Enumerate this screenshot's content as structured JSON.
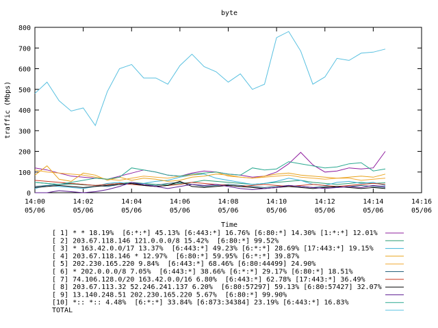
{
  "chart_data": {
    "type": "line",
    "title": "byte",
    "xlabel": "Time",
    "ylabel": "traffic (Mbps)",
    "xlim": [
      0,
      16
    ],
    "ylim": [
      0,
      800
    ],
    "grid": false,
    "legend_placement": "bottom",
    "x_ticks": [
      {
        "value": 0,
        "time": "14:00",
        "date": "05/06"
      },
      {
        "value": 2,
        "time": "14:02",
        "date": "05/06"
      },
      {
        "value": 4,
        "time": "14:04",
        "date": "05/06"
      },
      {
        "value": 6,
        "time": "14:06",
        "date": "05/06"
      },
      {
        "value": 8,
        "time": "14:08",
        "date": "05/06"
      },
      {
        "value": 10,
        "time": "14:10",
        "date": "05/06"
      },
      {
        "value": 12,
        "time": "14:12",
        "date": "05/06"
      },
      {
        "value": 14,
        "time": "14:14",
        "date": "05/06"
      },
      {
        "value": 16,
        "time": "14:16",
        "date": "05/06"
      }
    ],
    "y_ticks": [
      0,
      100,
      200,
      300,
      400,
      500,
      600,
      700,
      800
    ],
    "x": [
      0,
      0.5,
      1,
      1.5,
      2,
      2.5,
      3,
      3.5,
      4,
      4.5,
      5,
      5.5,
      6,
      6.5,
      7,
      7.5,
      8,
      8.5,
      9,
      9.5,
      10,
      10.5,
      11,
      11.5,
      12,
      12.5,
      13,
      13.5,
      14,
      14.5
    ],
    "series": [
      {
        "name": "[ 1] * * 18.19%  [6:*:*] 45.13% [6:443:*] 16.76% [6:80:*] 14.30% [1:*:*] 12.01%",
        "color": "#8e1c9e",
        "values": [
          120,
          110,
          95,
          80,
          75,
          70,
          65,
          80,
          95,
          110,
          100,
          85,
          80,
          95,
          105,
          100,
          90,
          85,
          75,
          80,
          100,
          140,
          195,
          135,
          100,
          105,
          120,
          115,
          120,
          200
        ]
      },
      {
        "name": "[ 2] 203.67.118.146 121.0.0.0/8 15.42%  [6:80:*] 99.52%",
        "color": "#2a9c74",
        "values": [
          50,
          45,
          40,
          42,
          38,
          35,
          40,
          45,
          50,
          45,
          40,
          38,
          45,
          50,
          60,
          55,
          50,
          45,
          40,
          45,
          50,
          55,
          60,
          50,
          45,
          40,
          45,
          50,
          45,
          48
        ]
      },
      {
        "name": "[ 3] * 163.42.0.0/17 13.37%  [6:443:*] 49.23% [6:*:*] 28.69% [17:443:*] 19.15%",
        "color": "#3cb2d8",
        "values": [
          20,
          35,
          30,
          25,
          20,
          30,
          45,
          50,
          40,
          45,
          55,
          60,
          75,
          85,
          90,
          70,
          60,
          50,
          40,
          45,
          55,
          70,
          60,
          40,
          35,
          50,
          55,
          45,
          50,
          35
        ]
      },
      {
        "name": "[ 4] 203.67.118.146 * 12.97%  [6:80:*] 59.95% [6:*:*] 39.87%",
        "color": "#e8a21a",
        "values": [
          85,
          130,
          65,
          55,
          95,
          85,
          60,
          75,
          60,
          70,
          65,
          55,
          60,
          75,
          80,
          90,
          85,
          75,
          70,
          80,
          90,
          95,
          85,
          80,
          75,
          70,
          75,
          80,
          75,
          90
        ]
      },
      {
        "name": "[ 5] 202.230.165.220 9.84%  [6:443:*] 68.46% [6:80:44499] 24.90%",
        "color": "#f0a830",
        "values": [
          110,
          100,
          95,
          90,
          85,
          75,
          65,
          60,
          70,
          80,
          75,
          70,
          80,
          85,
          95,
          100,
          80,
          75,
          70,
          75,
          80,
          85,
          75,
          70,
          65,
          70,
          70,
          60,
          65,
          70
        ]
      },
      {
        "name": "[ 6] * 202.0.0.0/8 7.05%  [6:443:*] 38.66% [6:*:*] 29.17% [6:80:*] 18.51%",
        "color": "#25607a",
        "values": [
          30,
          35,
          40,
          45,
          40,
          35,
          30,
          40,
          45,
          40,
          35,
          45,
          50,
          40,
          30,
          35,
          40,
          35,
          30,
          25,
          30,
          35,
          30,
          25,
          30,
          25,
          30,
          35,
          30,
          25
        ]
      },
      {
        "name": "[ 7] 74.106.128.0/20 163.42.0.0/16 6.80%  [6:443:*] 62.78% [17:443:*] 36.49%",
        "color": "#c83820",
        "values": [
          60,
          55,
          50,
          45,
          40,
          35,
          40,
          45,
          40,
          35,
          30,
          35,
          40,
          50,
          45,
          40,
          35,
          30,
          35,
          40,
          35,
          30,
          35,
          40,
          35,
          30,
          35,
          40,
          45,
          40
        ]
      },
      {
        "name": "[ 8] 203.67.113.32 52.246.241.137 6.20%  [6:80:57297] 59.13% [6:80:57427] 32.07%",
        "color": "#000000",
        "values": [
          25,
          30,
          35,
          30,
          25,
          30,
          35,
          40,
          45,
          35,
          30,
          35,
          55,
          30,
          25,
          30,
          35,
          30,
          25,
          20,
          25,
          30,
          25,
          20,
          25,
          30,
          25,
          20,
          25,
          20
        ]
      },
      {
        "name": "[ 9] 13.140.248.51 202.230.165.220 5.67%  [6:80:*] 99.90%",
        "color": "#5a1890",
        "values": [
          0,
          0,
          10,
          5,
          0,
          5,
          15,
          30,
          50,
          40,
          30,
          20,
          30,
          40,
          35,
          40,
          30,
          20,
          15,
          20,
          25,
          35,
          30,
          25,
          20,
          25,
          30,
          25,
          35,
          30
        ]
      },
      {
        "name": "[10] *:: *:: 4.48%  [6:*:*] 33.84% [6:873:34384] 23.19% [6:443:*] 16.83%",
        "color": "#28a890",
        "values": [
          50,
          45,
          40,
          50,
          60,
          70,
          65,
          75,
          120,
          110,
          100,
          85,
          80,
          90,
          95,
          100,
          90,
          85,
          120,
          110,
          115,
          150,
          140,
          130,
          120,
          125,
          140,
          145,
          105,
          115
        ]
      },
      {
        "name": "TOTAL",
        "color": "#58c0e0",
        "values": [
          480,
          535,
          445,
          395,
          410,
          325,
          490,
          600,
          620,
          555,
          555,
          525,
          615,
          670,
          610,
          585,
          535,
          575,
          500,
          525,
          750,
          780,
          685,
          525,
          560,
          650,
          640,
          675,
          680,
          695
        ]
      }
    ]
  }
}
